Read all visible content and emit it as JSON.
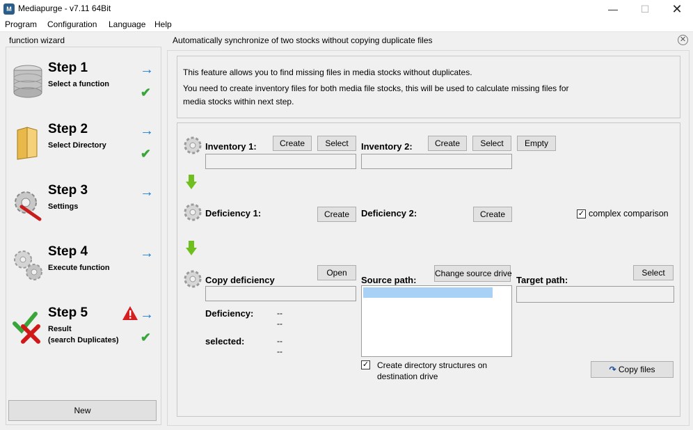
{
  "window": {
    "title": "Mediapurge - v7.11 64Bit",
    "icon_text": "M"
  },
  "menu": [
    "Program",
    "Configuration",
    "Language",
    "Help"
  ],
  "sidebar": {
    "title": "function wizard",
    "steps": [
      {
        "title": "Step 1",
        "subtitle": "Select a function",
        "done": true
      },
      {
        "title": "Step 2",
        "subtitle": "Select Directory",
        "done": true
      },
      {
        "title": "Step 3",
        "subtitle": "Settings",
        "done": false
      },
      {
        "title": "Step 4",
        "subtitle": "Execute function",
        "done": false
      },
      {
        "title": "Step 5",
        "subtitle": "Result",
        "subtitle2": "(search Duplicates)",
        "done": true
      }
    ],
    "new_button": "New"
  },
  "main": {
    "header": "Automatically synchronize of two stocks without copying duplicate files",
    "info_line1": "This feature allows you to find missing files in media stocks without duplicates.",
    "info_line2": "You need to create inventory files for both media file stocks, this will be used to calculate missing files for",
    "info_line3": "media stocks within next step.",
    "inventory1": {
      "label": "Inventory 1:",
      "create": "Create",
      "select": "Select",
      "value": ""
    },
    "inventory2": {
      "label": "Inventory 2:",
      "create": "Create",
      "select": "Select",
      "empty": "Empty",
      "value": ""
    },
    "deficiency1": {
      "label": "Deficiency 1:",
      "create": "Create"
    },
    "deficiency2": {
      "label": "Deficiency 2:",
      "create": "Create"
    },
    "complex_comparison": {
      "label": "complex comparison",
      "checked": true
    },
    "copy_deficiency": {
      "label": "Copy deficiency",
      "open": "Open",
      "value": ""
    },
    "source_path": {
      "label": "Source path:",
      "change": "Change source drive"
    },
    "target_path": {
      "label": "Target path:",
      "select": "Select",
      "value": ""
    },
    "stats": {
      "deficiency_label": "Deficiency:",
      "deficiency_val1": "--",
      "deficiency_val2": "--",
      "selected_label": "selected:",
      "selected_val1": "--",
      "selected_val2": "--"
    },
    "create_dirs": {
      "line1": "Create directory structures on",
      "line2": "destination drive",
      "checked": true
    },
    "copy_files": "Copy files"
  },
  "colors": {
    "arrow_blue": "#1a7fd6",
    "check_green": "#3aa53a",
    "selection": "#a8d1f5"
  }
}
